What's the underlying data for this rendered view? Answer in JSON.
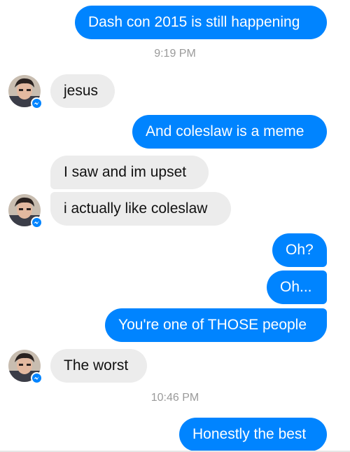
{
  "messages": [
    {
      "text": "Dash con 2015 is still happening",
      "from": "me"
    },
    {
      "text": "jesus",
      "from": "them"
    },
    {
      "text": "And coleslaw is a meme",
      "from": "me"
    },
    {
      "text": "I saw and im upset",
      "from": "them"
    },
    {
      "text": "i actually like coleslaw",
      "from": "them"
    },
    {
      "text": "Oh?",
      "from": "me"
    },
    {
      "text": "Oh...",
      "from": "me"
    },
    {
      "text": "You're one of THOSE people",
      "from": "me"
    },
    {
      "text": "The worst",
      "from": "them"
    },
    {
      "text": "Honestly the best",
      "from": "me"
    }
  ],
  "timestamps": [
    "9:19 PM",
    "10:46 PM"
  ],
  "colors": {
    "outgoing_bubble": "#0084ff",
    "incoming_bubble": "#ececec",
    "timestamp_text": "#9a9a9a"
  },
  "icons": {
    "avatar": "contact-avatar",
    "badge": "messenger-badge-icon"
  }
}
